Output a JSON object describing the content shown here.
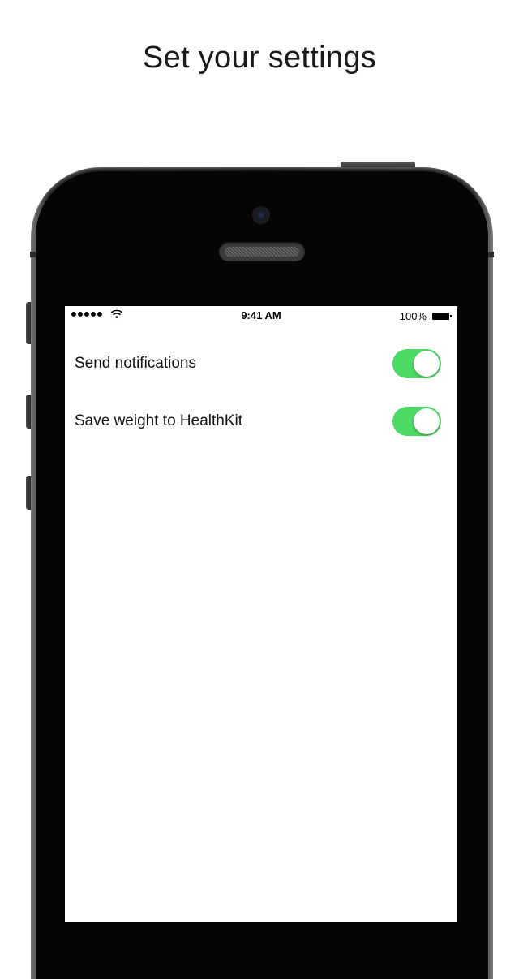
{
  "headline": "Set your settings",
  "status_bar": {
    "time": "9:41 AM",
    "battery_percent": "100%",
    "signal_bars": 5,
    "icons": [
      "signal-dots-icon",
      "wifi-icon",
      "battery-icon"
    ]
  },
  "settings": [
    {
      "label": "Send notifications",
      "enabled": true
    },
    {
      "label": "Save weight to HealthKit",
      "enabled": true
    }
  ],
  "colors": {
    "toggle_on": "#4cd964",
    "screen_background": "#ffffff",
    "device_body": "#050505"
  }
}
